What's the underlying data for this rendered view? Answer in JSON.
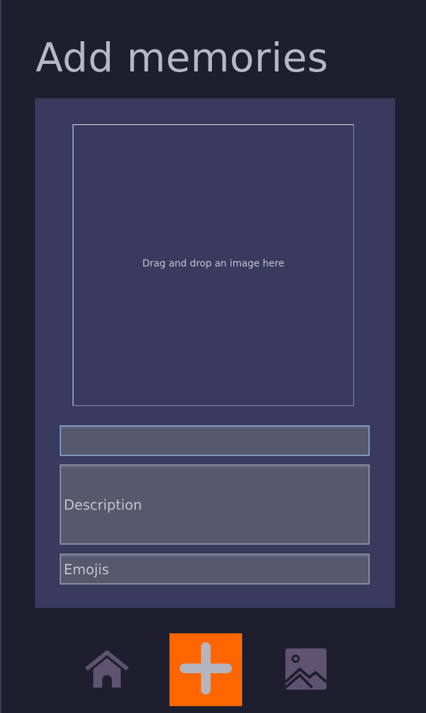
{
  "page": {
    "title": "Add memories"
  },
  "form": {
    "dropzone_text": "Drag and drop an image here",
    "title_field": {
      "value": "",
      "placeholder": ""
    },
    "description_field": {
      "placeholder": "Description"
    },
    "emoji_field": {
      "placeholder": "Emojis"
    }
  },
  "nav": {
    "items": [
      {
        "name": "home",
        "icon": "home-icon"
      },
      {
        "name": "add",
        "icon": "plus-icon",
        "active": true
      },
      {
        "name": "gallery",
        "icon": "image-icon"
      }
    ]
  },
  "colors": {
    "background": "#1e1e2f",
    "card": "#393a5e",
    "field": "#56586e",
    "accent": "#ff6600",
    "icon_muted": "#5e5370",
    "text": "#b8b8c4"
  }
}
